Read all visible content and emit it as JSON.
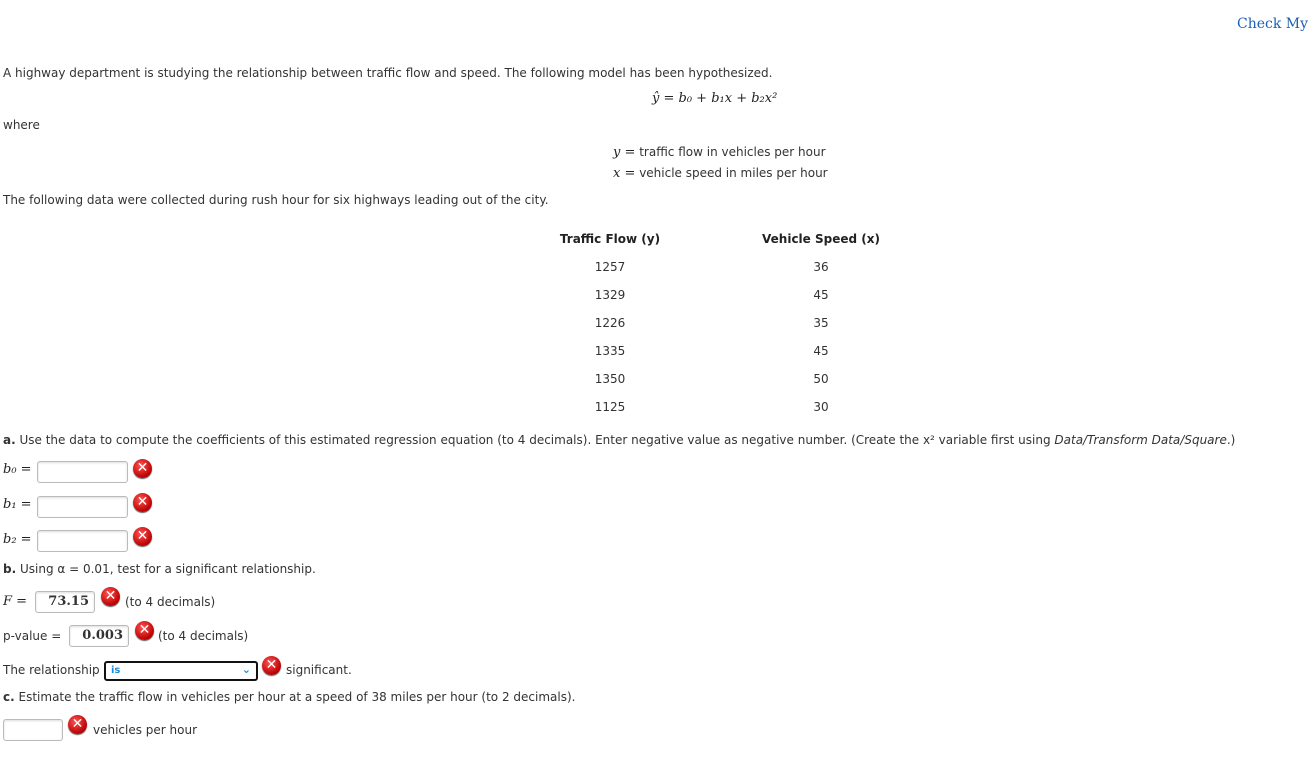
{
  "header": {
    "check_link": "Check My W"
  },
  "intro": "A highway department is studying the relationship between traffic flow and speed. The following model has been hypothesized.",
  "equation": "ŷ = b₀ + b₁x + b₂x²",
  "where": "where",
  "definitions": [
    {
      "symbol": "y =",
      "text": "traffic flow in vehicles per hour"
    },
    {
      "symbol": "x =",
      "text": "vehicle speed in miles per hour"
    }
  ],
  "data_intro": "The following data were collected during rush hour for six highways leading out of the city.",
  "table": {
    "headers": [
      "Traffic Flow (y)",
      "Vehicle Speed (x)"
    ],
    "rows": [
      [
        "1257",
        "36"
      ],
      [
        "1329",
        "45"
      ],
      [
        "1226",
        "35"
      ],
      [
        "1335",
        "45"
      ],
      [
        "1350",
        "50"
      ],
      [
        "1125",
        "30"
      ]
    ]
  },
  "part_a": {
    "label": "a.",
    "text": "Use the data to compute the coefficients of this estimated regression equation (to 4 decimals). Enter negative value as negative number. (Create the x² variable first using ",
    "italic": "Data/Transform Data/Square",
    ".": ".)",
    "end": ".)",
    "fields": [
      {
        "label": "b₀ =",
        "value": ""
      },
      {
        "label": "b₁ =",
        "value": ""
      },
      {
        "label": "b₂ =",
        "value": ""
      }
    ]
  },
  "part_b": {
    "label": "b.",
    "text": "Using α = 0.01, test for a significant relationship.",
    "f_label": "F =",
    "f_value": "73.15",
    "f_hint": "(to 4 decimals)",
    "p_label": "p-value =",
    "p_value": "0.003",
    "p_hint": "(to 4 decimals)",
    "rel_prefix": "The relationship",
    "rel_selected": "is",
    "rel_suffix": "significant."
  },
  "part_c": {
    "label": "c.",
    "text": "Estimate the traffic flow in vehicles per hour at a speed of 38 miles per hour (to 2 decimals).",
    "value": "",
    "unit": "vehicles per hour"
  },
  "icons": {
    "incorrect": "incorrect-x-icon",
    "dropdown": "chevron-down-icon"
  },
  "colors": {
    "link": "#1a5fb4",
    "error": "#cc0000",
    "select_text": "#1a8ad4"
  }
}
